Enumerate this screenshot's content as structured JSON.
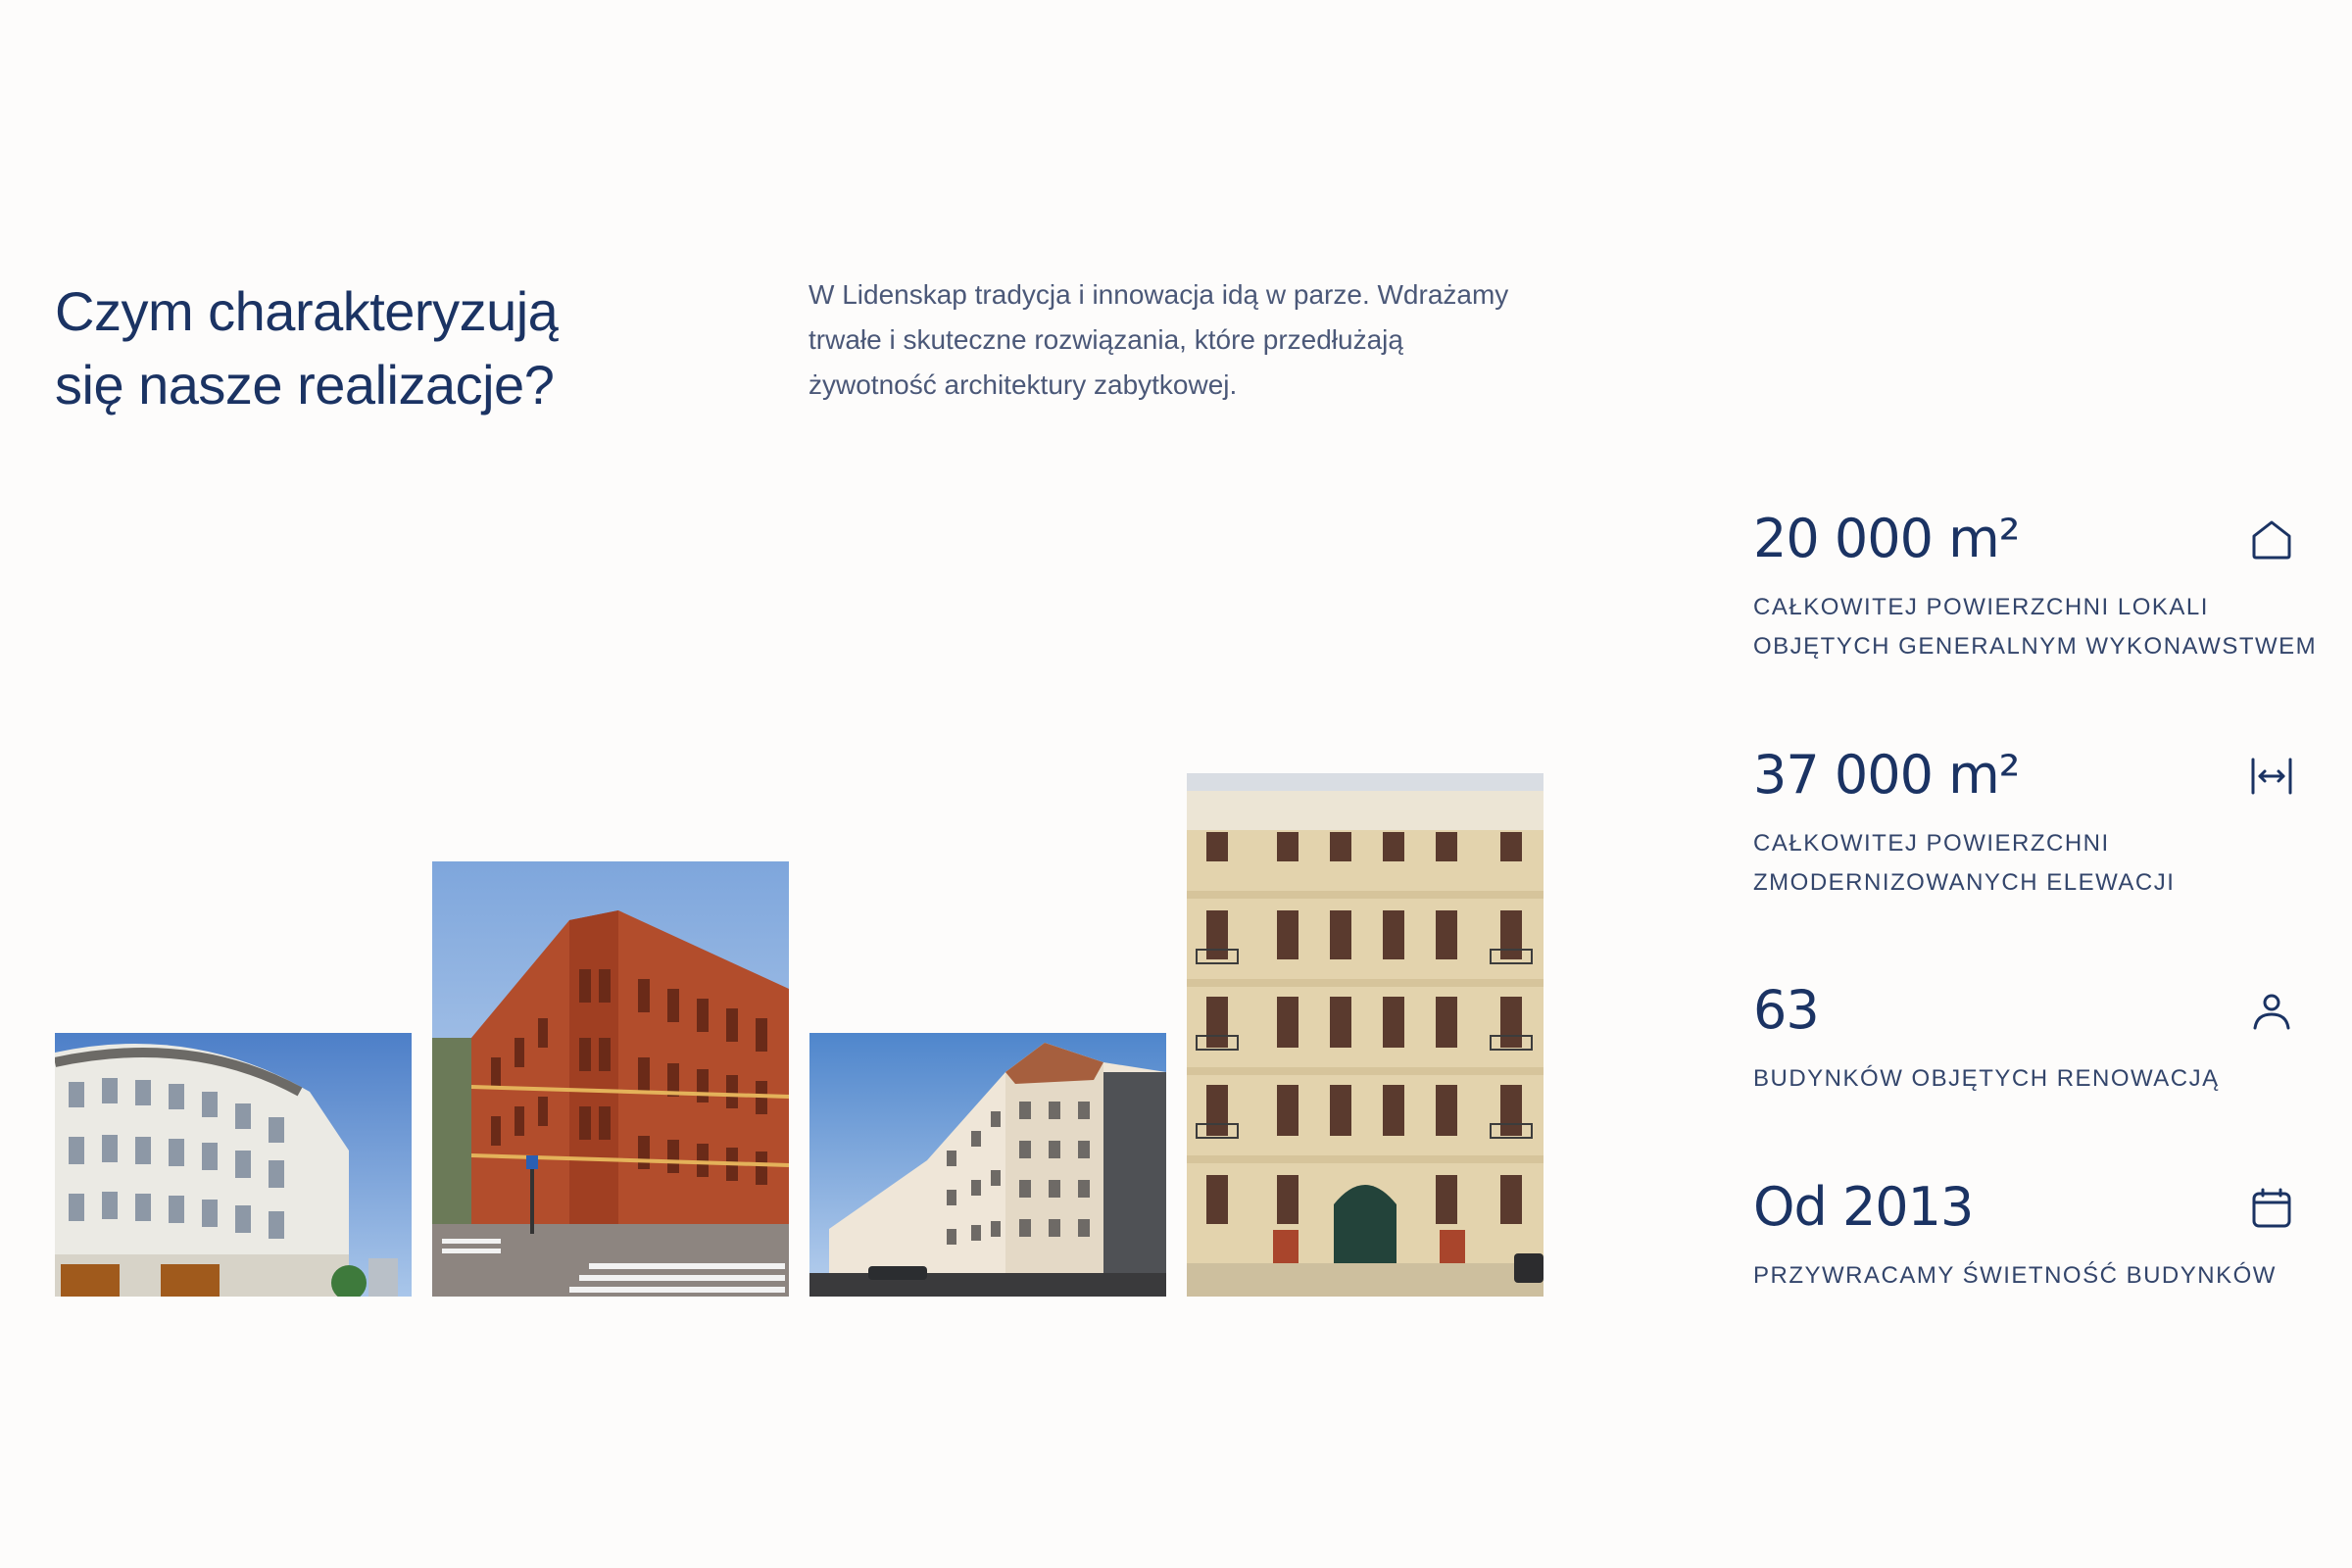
{
  "section": {
    "heading_line1": "Czym charakteryzują",
    "heading_line2": "się nasze realizacje?",
    "intro_line1": "W Lidenskap tradycja i innowacja idą w parze. Wdrażamy",
    "intro_line2": "trwałe i skuteczne rozwiązania, które przedłużają",
    "intro_line3": "żywotność architektury zabytkowej."
  },
  "gallery": [
    {
      "subject": "white ornate tenement building"
    },
    {
      "subject": "red brick corner building"
    },
    {
      "subject": "cream tenement on street corner"
    },
    {
      "subject": "restored beige tenement facade"
    }
  ],
  "stats": [
    {
      "value": "20 000 m²",
      "desc_line1": "CAŁKOWITEJ POWIERZCHNI LOKALI",
      "desc_line2": "OBJĘTYCH GENERALNYM WYKONAWSTWEM",
      "icon": "home-icon"
    },
    {
      "value": "37 000 m²",
      "desc_line1": "CAŁKOWITEJ POWIERZCHNI",
      "desc_line2": "ZMODERNIZOWANYCH ELEWACJI",
      "icon": "width-arrows-icon"
    },
    {
      "value": "63",
      "desc_line1": "BUDYNKÓW OBJĘTYCH RENOWACJĄ",
      "icon": "person-icon"
    },
    {
      "value": "Od 2013",
      "desc_line1": "PRZYWRACAMY ŚWIETNOŚĆ BUDYNKÓW",
      "icon": "calendar-icon"
    }
  ],
  "colors": {
    "background": "#fdfcfb",
    "text_primary": "#1b3363",
    "text_secondary": "#4b5878"
  }
}
